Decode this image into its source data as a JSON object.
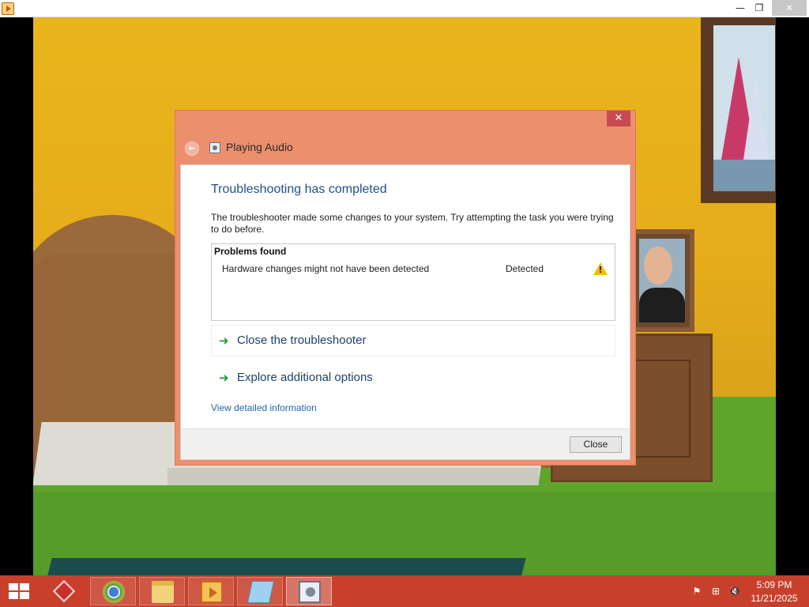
{
  "window": {
    "minimize_glyph": "—",
    "maximize_glyph": "❐",
    "close_glyph": "✕"
  },
  "dialog": {
    "title": "Playing Audio",
    "close_glyph": "✕",
    "back_glyph": "←",
    "heading": "Troubleshooting has completed",
    "description": "The troubleshooter made some changes to your system. Try attempting the task you were trying to do before.",
    "problems": {
      "title": "Problems found",
      "rows": [
        {
          "name": "Hardware changes might not have been detected",
          "status": "Detected",
          "icon": "warning-icon"
        }
      ]
    },
    "options": [
      {
        "label": "Close the troubleshooter",
        "icon": "green-arrow-icon"
      },
      {
        "label": "Explore additional options",
        "icon": "green-arrow-icon"
      }
    ],
    "details_link": "View detailed information",
    "close_button": "Close",
    "arrow_glyph": "➜",
    "warning_glyph": "!"
  },
  "taskbar": {
    "items": [
      "dropbox-icon",
      "chrome-icon",
      "file-explorer-icon",
      "media-player-icon",
      "notepad-icon",
      "troubleshooter-icon"
    ],
    "tray_flag": "⚑",
    "tray_network": "⊞",
    "tray_volume": "🔇",
    "clock": {
      "time": "5:09 PM",
      "date": "11/21/2025"
    }
  },
  "colors": {
    "dialog_frame": "#ec8f6d",
    "taskbar": "#c8402c",
    "heading": "#1f4f8c",
    "link": "#1e66b0",
    "close_red": "#c74b50"
  }
}
